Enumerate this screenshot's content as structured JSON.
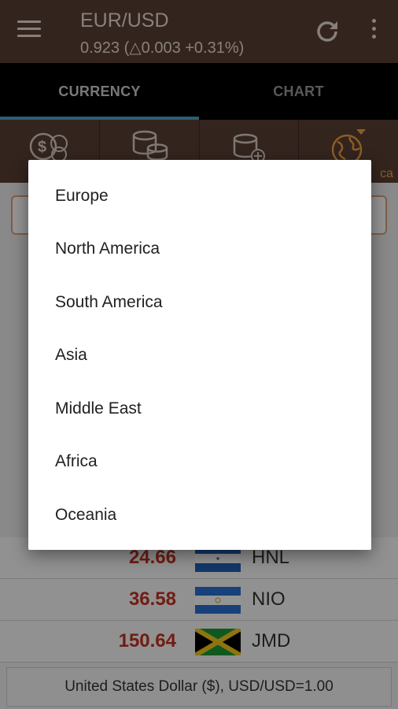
{
  "app_bar": {
    "title": "EUR/USD",
    "subtitle": "0.923 (△0.003 +0.31%)",
    "menu_icon": "hamburger-menu-icon",
    "refresh_icon": "refresh-icon",
    "more_icon": "more-vertical-icon"
  },
  "tabs": [
    {
      "label": "CURRENCY",
      "active": true
    },
    {
      "label": "CHART",
      "active": false
    }
  ],
  "toolbar": {
    "icons": [
      "money-exchange-icon",
      "coin-stack-icon",
      "coin-add-icon",
      "globe-icon"
    ],
    "globe_label": "ca"
  },
  "rows": [
    {
      "value": "24.66",
      "code": "HNL",
      "flag": "honduras-flag"
    },
    {
      "value": "36.58",
      "code": "NIO",
      "flag": "nicaragua-flag"
    },
    {
      "value": "150.64",
      "code": "JMD",
      "flag": "jamaica-flag"
    }
  ],
  "footer": {
    "text": "United States Dollar ($), USD/USD=1.00"
  },
  "dropdown": {
    "options": [
      "Europe",
      "North America",
      "South America",
      "Asia",
      "Middle East",
      "Africa",
      "Oceania"
    ]
  },
  "colors": {
    "appbar": "#5a3e35",
    "tab_indicator": "#46a7c9",
    "value_red": "#c23322",
    "accent_orange": "#f0a040"
  }
}
